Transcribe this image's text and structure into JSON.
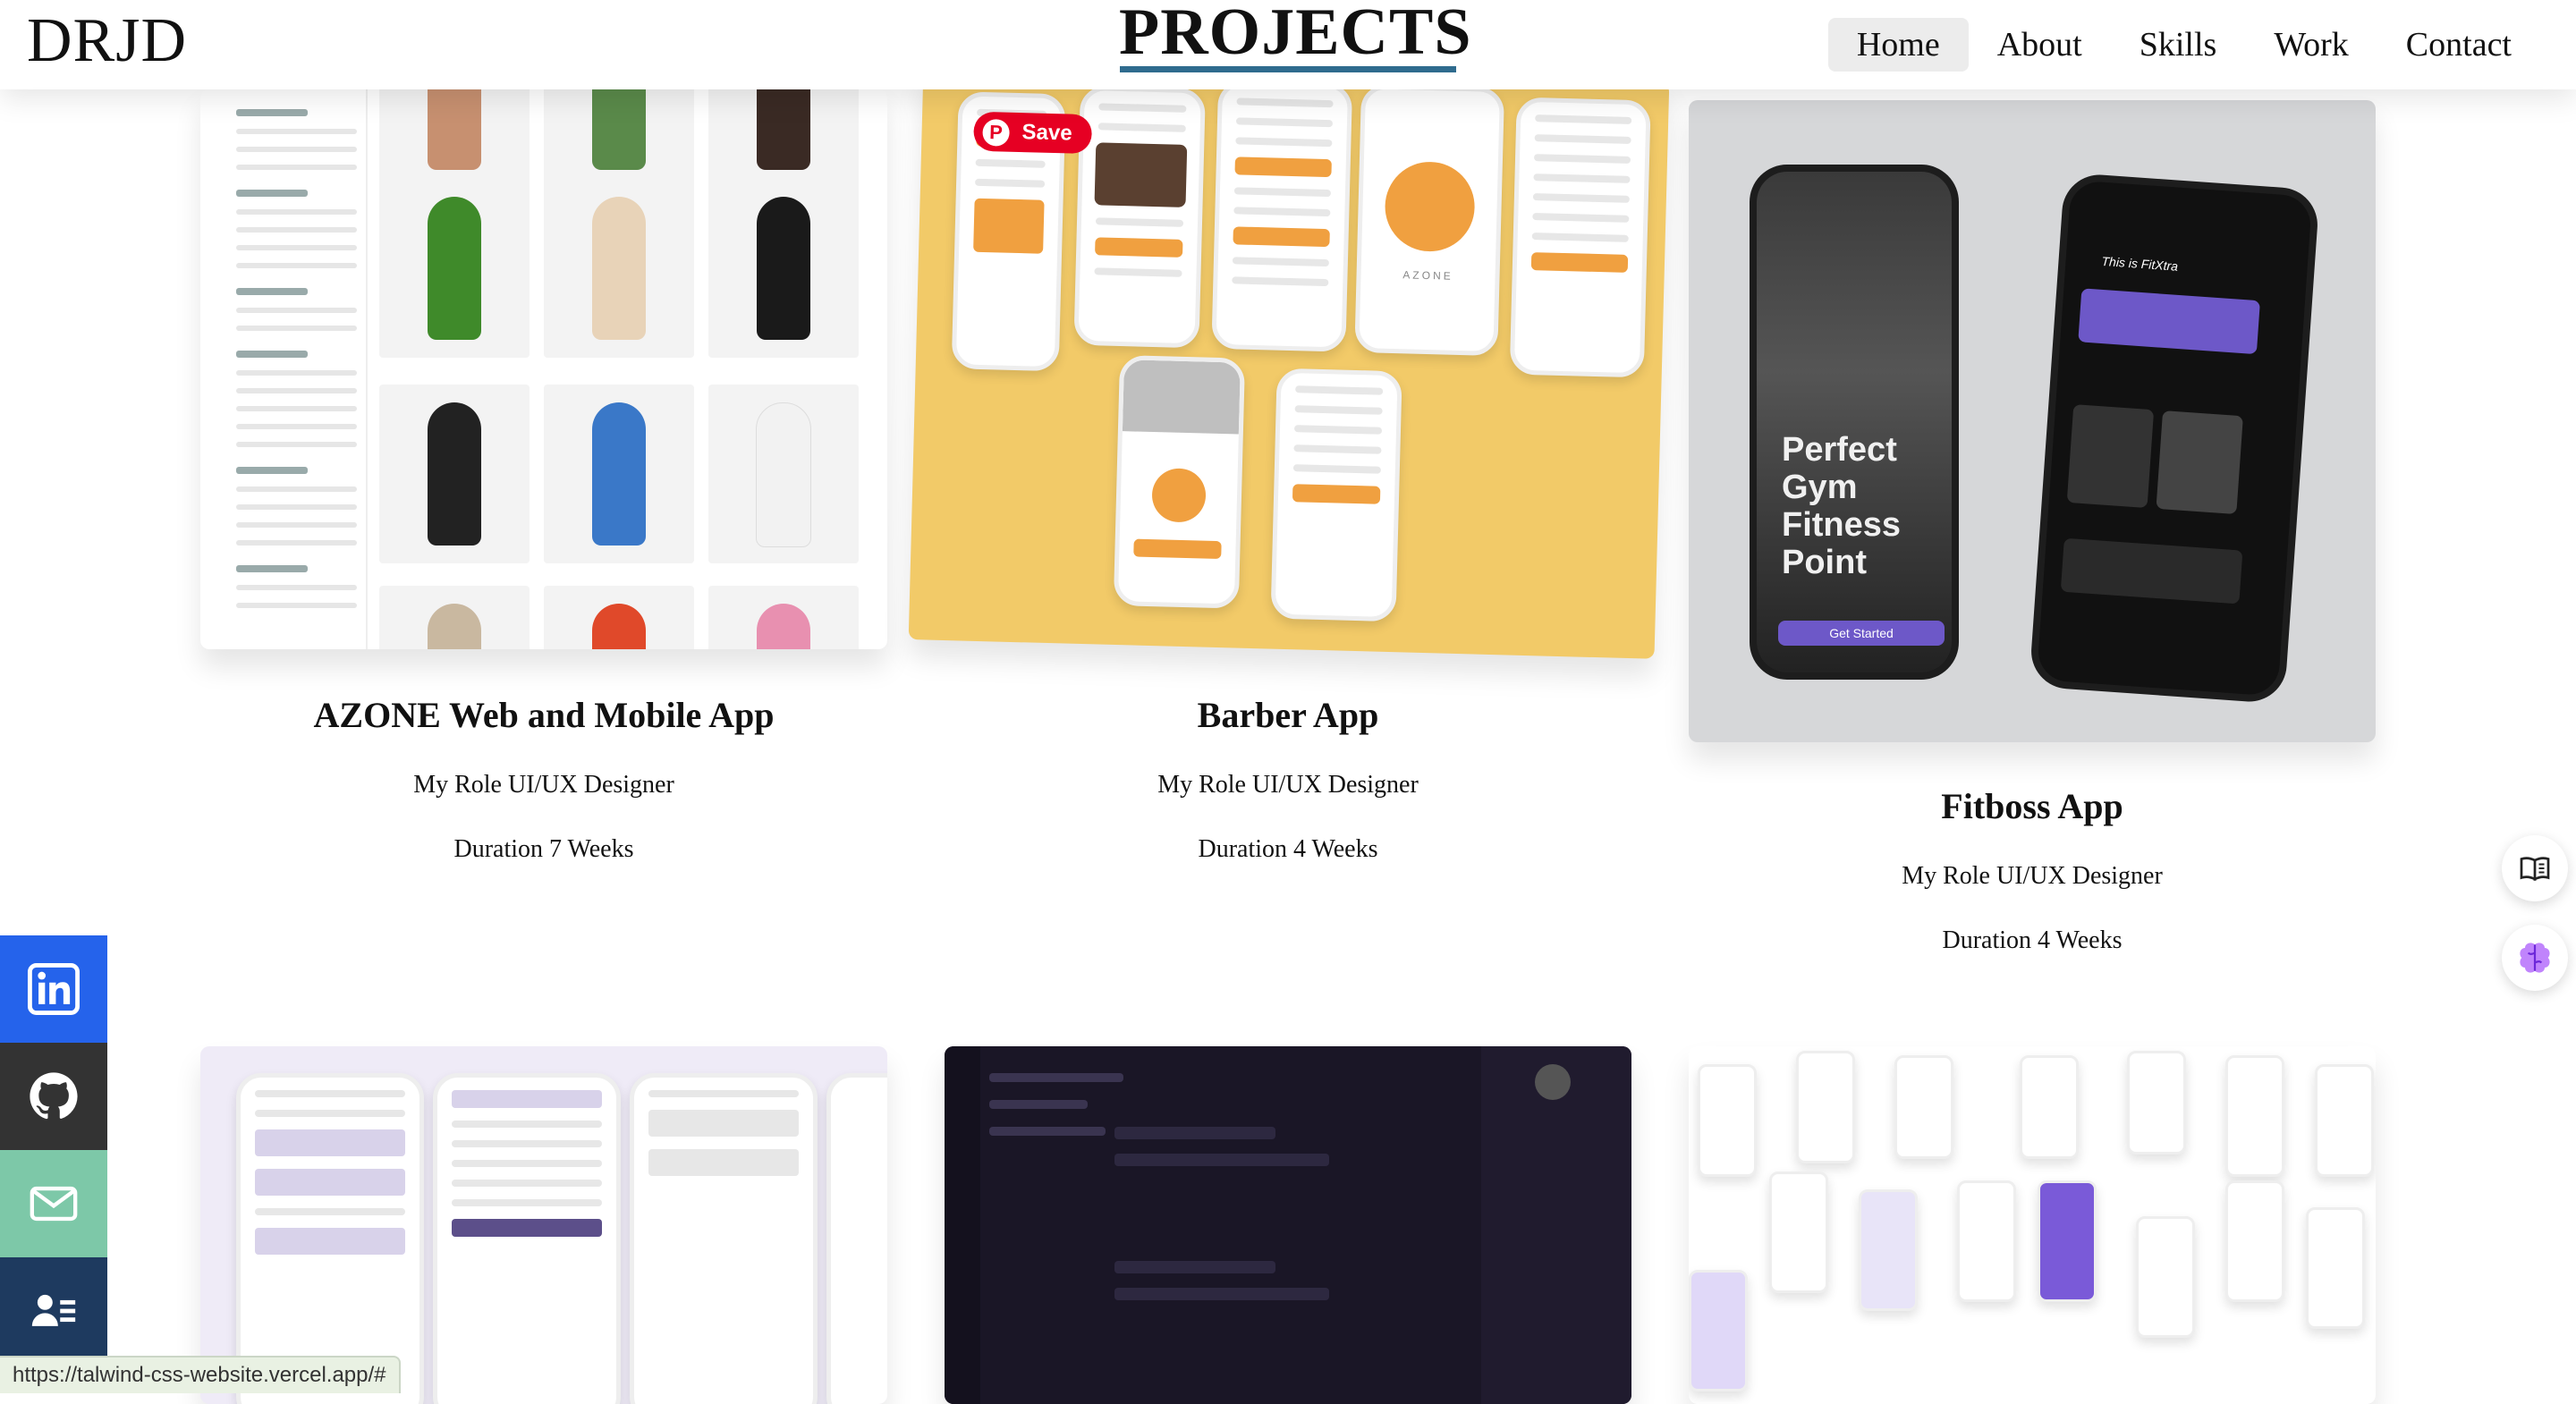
{
  "header": {
    "logo": "DRJD",
    "heading": "PROJECTS",
    "nav": [
      {
        "label": "Home",
        "active": true
      },
      {
        "label": "About"
      },
      {
        "label": "Skills"
      },
      {
        "label": "Work"
      },
      {
        "label": "Contact"
      }
    ]
  },
  "projects": [
    {
      "title": "AZONE Web and Mobile App",
      "role": "My Role UI/UX Designer",
      "duration": "Duration 7 Weeks"
    },
    {
      "title": "Barber App",
      "role": "My Role UI/UX Designer",
      "duration": "Duration 4 Weeks",
      "save_label": "Save"
    },
    {
      "title": "Fitboss App",
      "role": "My Role UI/UX Designer",
      "duration": "Duration 4 Weeks",
      "promo_text": "Perfect Gym Fitness Point",
      "cta": "Get Started",
      "app_heading": "This is FitXtra"
    }
  ],
  "social_icons": [
    {
      "name": "linkedin-icon",
      "color": "#2563eb"
    },
    {
      "name": "github-icon",
      "color": "#333333"
    },
    {
      "name": "mail-icon",
      "color": "#7dc8a8"
    },
    {
      "name": "resume-icon",
      "color": "#1e3a5f"
    }
  ],
  "status_url": "https://talwind-css-website.vercel.app/#",
  "colors": {
    "accent_underline": "#2f6b8e",
    "barber_bg": "#f2ca68",
    "fitboss_bg": "#d6d7d9",
    "pinterest": "#e60023"
  }
}
